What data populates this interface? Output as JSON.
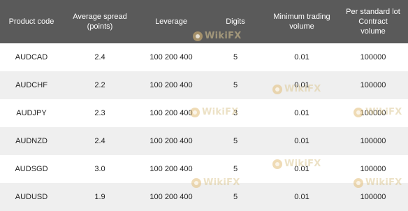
{
  "table": {
    "headers": {
      "product_code": "Product code",
      "average_spread": [
        "Average spread",
        "(points)"
      ],
      "leverage": "Leverage",
      "digits": "Digits",
      "minimum_trading_volume": [
        "Minimum trading",
        "volume"
      ],
      "per_standard_lot": [
        "Per standard lot",
        "Contract",
        "volume"
      ]
    },
    "rows": [
      {
        "product_code": "AUDCAD",
        "average_spread": "2.4",
        "leverage": "100 200 400",
        "digits": "5",
        "minimum_trading_volume": "0.01",
        "contract_volume": "100000"
      },
      {
        "product_code": "AUDCHF",
        "average_spread": "2.2",
        "leverage": "100 200 400",
        "digits": "5",
        "minimum_trading_volume": "0.01",
        "contract_volume": "100000"
      },
      {
        "product_code": "AUDJPY",
        "average_spread": "2.3",
        "leverage": "100 200 400",
        "digits": "3",
        "minimum_trading_volume": "0.01",
        "contract_volume": "100000"
      },
      {
        "product_code": "AUDNZD",
        "average_spread": "2.4",
        "leverage": "100 200 400",
        "digits": "5",
        "minimum_trading_volume": "0.01",
        "contract_volume": "100000"
      },
      {
        "product_code": "AUDSGD",
        "average_spread": "3.0",
        "leverage": "100 200 400",
        "digits": "5",
        "minimum_trading_volume": "0.01",
        "contract_volume": "100000"
      },
      {
        "product_code": "AUDUSD",
        "average_spread": "1.9",
        "leverage": "100 200 400",
        "digits": "5",
        "minimum_trading_volume": "0.01",
        "contract_volume": "100000"
      }
    ]
  },
  "watermark": {
    "text": "WikiFX"
  },
  "colors": {
    "header_bg": "#5a5a5a",
    "header_text": "#ffffff",
    "row_alt_bg": "#efefef",
    "row_bg": "#ffffff"
  }
}
